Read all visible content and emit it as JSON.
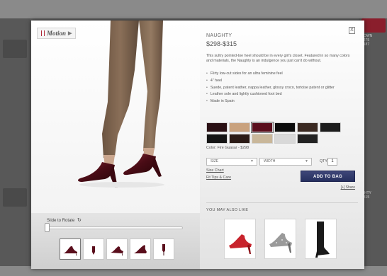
{
  "background": {
    "right_text_top": [
      "TOWN",
      "$275",
      "$187"
    ],
    "right_text_bottom": [
      "GHTY",
      "$315"
    ]
  },
  "media": {
    "motion_label": "Motion",
    "rotate_label": "Slide to Rotate",
    "rotate_icon": "rotate-icon",
    "slider_value": 0,
    "thumbnails": [
      {
        "view": "side"
      },
      {
        "view": "front"
      },
      {
        "view": "angle"
      },
      {
        "view": "three-quarter"
      },
      {
        "view": "back"
      }
    ]
  },
  "product": {
    "name": "NAUGHTY",
    "price": "$298-$315",
    "description": "This sultry pointed-toe heel should be in every girl's closet. Featured in so many colors and materials, the Naughty is an indulgence you just can't do without.",
    "features": [
      "Flirty low-cut sides for an ultra feminine feel",
      "4\" heel",
      "Suede, patent leather, nappa leather, glossy croco, tortoise patent or glitter",
      "Leather sole and lightly cushioned foot bed",
      "Made in Spain"
    ],
    "color_label": "Color: Fire Guasar - $298",
    "swatches": [
      {
        "color": "#2a1014",
        "selected": false
      },
      {
        "color": "#c9a27e",
        "selected": false
      },
      {
        "color": "#5a0e1c",
        "selected": true
      },
      {
        "color": "#0c0c0c",
        "selected": false
      },
      {
        "color": "#3b2a22",
        "selected": false
      },
      {
        "color": "#1d1d1d",
        "selected": false
      },
      {
        "color": "#141414",
        "selected": false
      },
      {
        "color": "#2b1b16",
        "selected": false
      },
      {
        "color": "#c9b79a",
        "selected": false
      },
      {
        "color": "#d8d8d8",
        "selected": false
      },
      {
        "color": "#222222",
        "selected": false
      }
    ],
    "size_placeholder": "SIZE",
    "width_placeholder": "WIDTH",
    "qty_label": "QTY",
    "qty_value": "1",
    "size_chart": "Size Chart",
    "fit_tips": "Fit Tips & Care",
    "add_to_bag": "ADD TO BAG",
    "share": "[+] Share",
    "close": "X"
  },
  "recommendations": {
    "heading": "YOU MAY ALSO LIKE",
    "items": [
      {
        "kind": "red-pump",
        "color": "#c8232c"
      },
      {
        "kind": "glitter-pump",
        "color": "#9a9a9a"
      },
      {
        "kind": "black-boot",
        "color": "#1a1a1a"
      }
    ]
  },
  "colors": {
    "accent_button": "#2e376a",
    "shoe_main": "#5a0e1c"
  }
}
